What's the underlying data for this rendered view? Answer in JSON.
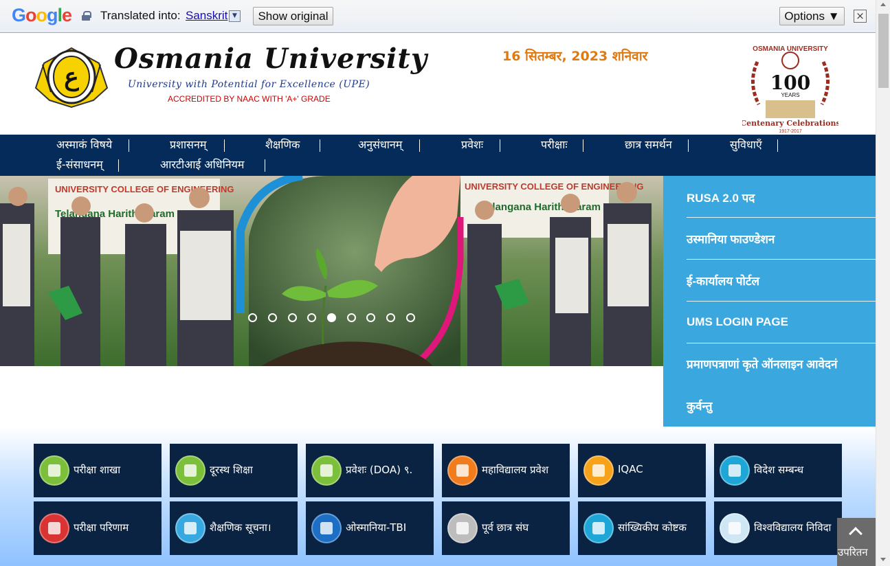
{
  "translate_bar": {
    "logo": "Google",
    "label": "Translated into:",
    "language": "Sanskrit",
    "dropdown_glyph": "▼",
    "show_original": "Show original",
    "options": "Options ▼",
    "close": "×"
  },
  "header": {
    "title": "Osmania University",
    "tagline": "University with Potential for Excellence (UPE)",
    "naac": "ACCREDITED BY NAAC WITH 'A+' GRADE",
    "date": "16 सितम्बर, 2023 शनिवार",
    "centenary_top": "OSMANIA UNIVERSITY",
    "centenary_number": "100",
    "centenary_years": "YEARS",
    "centenary_label": "Centenary Celebrations",
    "centenary_span": "1917-2017"
  },
  "nav": {
    "row1": [
      "अस्माकं विषये",
      "प्रशासनम्",
      "शैक्षणिक",
      "अनुसंधानम्",
      "प्रवेशः",
      "परीक्षाः",
      "छात्र समर्थन",
      "सुविधाएँ"
    ],
    "row2": [
      "ई-संसाधनम्",
      "आरटीआई अधिनियम"
    ]
  },
  "slider": {
    "banner_text": "UNIVERSITY COLLEGE OF ENGINEERING",
    "banner_text_2": "Telangana Harithaharam",
    "dot_count": 9,
    "active_dot": 5
  },
  "quick_links": [
    "RUSA 2.0 पद",
    "उस्मानिया फाउण्डेशन",
    "ई-कार्यालय पोर्टल",
    "UMS LOGIN PAGE",
    "प्रमाणपत्राणां कृते ऑनलाइन आवेदनं",
    "कुर्वन्तु"
  ],
  "tiles": [
    {
      "label": "परीक्षा शाखा",
      "icon": "school-building-icon",
      "color": "#7cbf3a"
    },
    {
      "label": "दूरस्थ शिक्षा",
      "icon": "laptop-icon",
      "color": "#7cbf3a"
    },
    {
      "label": "प्रवेशः (DOA) ९.",
      "icon": "graduation-cap-icon",
      "color": "#7cbf3a"
    },
    {
      "label": "महाविद्यालय प्रवेश",
      "icon": "form-icon",
      "color": "#f07c1d"
    },
    {
      "label": "IQAC",
      "icon": "thumbs-up-icon",
      "color": "#f7a21b"
    },
    {
      "label": "विदेश सम्बन्ध",
      "icon": "airplane-icon",
      "color": "#1ea6d6"
    },
    {
      "label": "परीक्षा परिणाम",
      "icon": "graduate-icon",
      "color": "#d83434"
    },
    {
      "label": "शैक्षणिक सूचना।",
      "icon": "pencil-icon",
      "color": "#38a8e0"
    },
    {
      "label": "ओस्मानिया-TBI",
      "icon": "people-icon",
      "color": "#1c6fc4"
    },
    {
      "label": "पूर्व छात्र संघ",
      "icon": "group-icon",
      "color": "#bdbdbd"
    },
    {
      "label": "सांख्यिकीय कोष्टक",
      "icon": "stairs-icon",
      "color": "#1ea6d6"
    },
    {
      "label": "विश्वविद्यालय निविदा",
      "icon": "minus-icon",
      "color": "#cfe6f5"
    }
  ],
  "back_to_top": "उपरितन"
}
